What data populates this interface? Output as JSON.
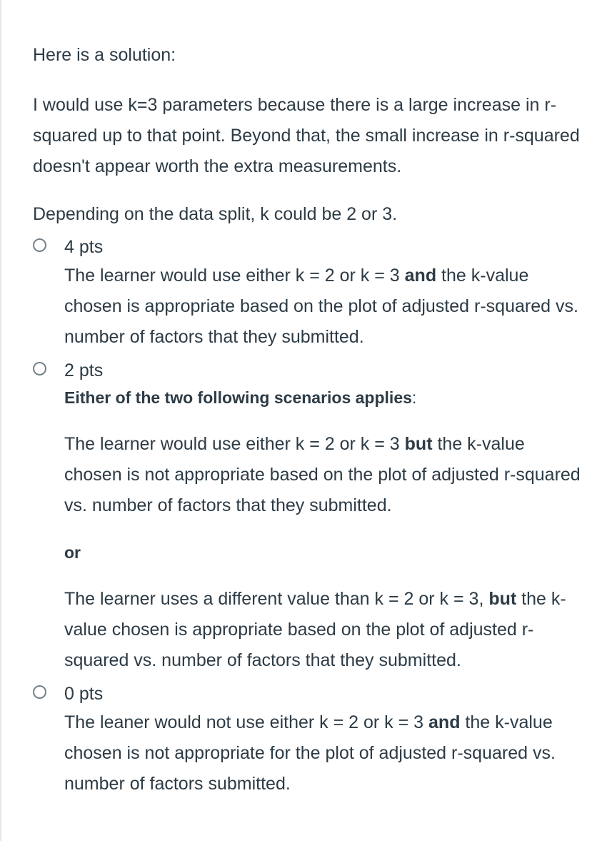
{
  "intro": "Here is a solution:",
  "answer": "I would use k=3 parameters because there is a large increase in r-squared up to that point. Beyond that, the small increase in r-squared doesn't appear worth the extra measurements.",
  "note": "Depending on the data split, k could be 2 or 3.",
  "options": [
    {
      "points": "4 pts",
      "desc_before": "The learner would use either k = 2 or k = 3 ",
      "desc_bold": "and",
      "desc_after": " the k-value chosen is appropriate based on the plot of adjusted r-squared vs. number of factors that they submitted."
    },
    {
      "points": "2 pts",
      "heading": "Either of the two following scenarios applies",
      "heading_suffix": ":",
      "scenario1_before": "The learner would use either k = 2 or k = 3 ",
      "scenario1_bold": "but",
      "scenario1_after": " the k-value chosen is not appropriate based on the plot of adjusted r-squared vs. number of factors that they submitted.",
      "or_label": "or",
      "scenario2_before": "The learner uses a different value than k = 2 or k = 3, ",
      "scenario2_bold": "but",
      "scenario2_after": " the k-value chosen is appropriate based on the plot of adjusted r-squared vs. number of factors that they submitted."
    },
    {
      "points": "0 pts",
      "desc_before": "The leaner would not use either k = 2 or k = 3 ",
      "desc_bold": "and",
      "desc_after": " the k-value chosen is not appropriate for the plot of adjusted r-squared vs. number of factors submitted."
    }
  ]
}
